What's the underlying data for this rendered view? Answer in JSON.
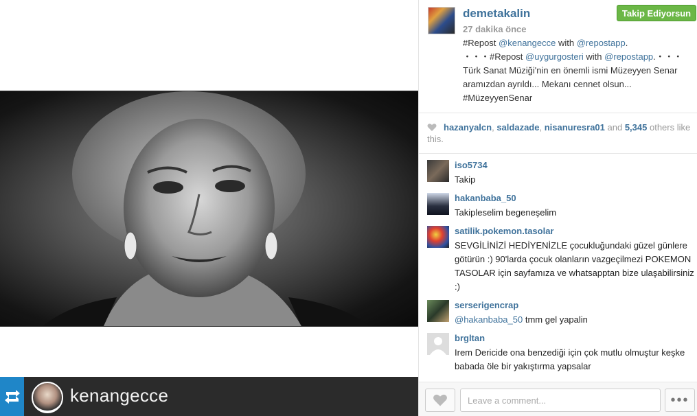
{
  "photo": {
    "alt_subject": "portrait",
    "repost_username": "kenangecce"
  },
  "post": {
    "owner": "demetakalin",
    "follow_label": "Takip Ediyorsun",
    "time": "27 dakika önce",
    "caption": {
      "line1_prefix": "#Repost ",
      "line1_mention": "@kenangecce",
      "line1_mid": " with ",
      "line1_app": "@repostapp",
      "line1_end": ".",
      "line2_prefix": "・・・#Repost ",
      "line2_mention": "@uygurgosteri",
      "line2_mid": " with ",
      "line2_app": "@repostapp",
      "line2_end": ".・・・",
      "body": "Türk Sanat Müziği'nin en önemli ismi Müzeyyen Senar aramızdan ayrıldı... Mekanı cennet olsun... #MüzeyyenSenar"
    }
  },
  "likes": {
    "user1": "hazanyalcn",
    "user2": "saldazade",
    "user3": "nisanuresra01",
    "and": " and ",
    "count": "5,345",
    "suffix": " others like this."
  },
  "comments": [
    {
      "user": "iso5734",
      "text": "Takip"
    },
    {
      "user": "hakanbaba_50",
      "text": "Takipleselim begeneşelim"
    },
    {
      "user": "satilik.pokemon.tasolar",
      "text": "SEVGİLİNİZİ HEDİYENİZLE çocukluğundaki güzel günlere götürün :) 90'larda çocuk olanların vazgeçilmezi POKEMON TASOLAR için sayfamıza ve whatsapptan bize ulaşabilirsiniz :)"
    },
    {
      "user": "serserigencrap",
      "mention": "@hakanbaba_50",
      "text": " tmm gel yapalin"
    },
    {
      "user": "brgltan",
      "text": "Irem Dericide ona benzediği için çok mutlu olmuştur keşke babada öle bir yakıştırma yapsalar"
    }
  ],
  "comment_bar": {
    "placeholder": "Leave a comment...",
    "more_label": "•••"
  },
  "colors": {
    "link": "#3f729b",
    "follow_green": "#6bb746",
    "repost_blue": "#1f86c8"
  }
}
